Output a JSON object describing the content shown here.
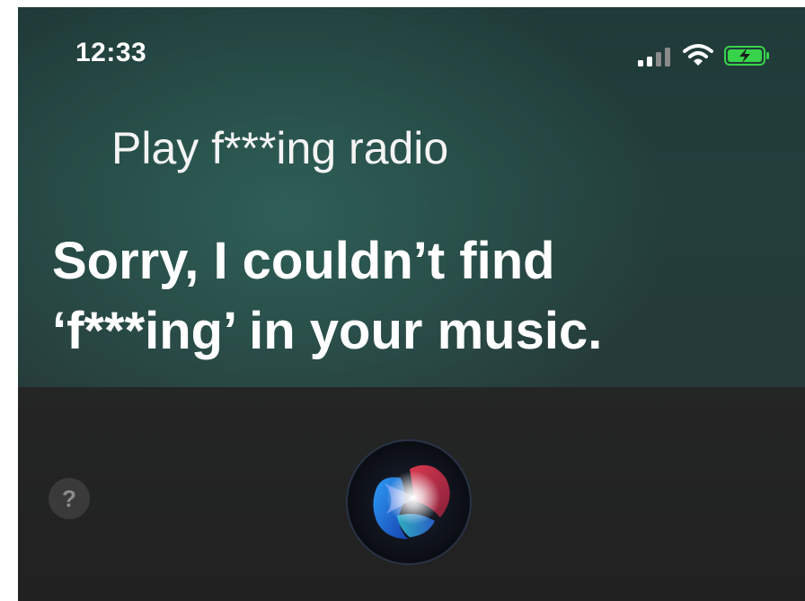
{
  "status_bar": {
    "time": "12:33",
    "icons": [
      "cellular-signal-icon",
      "wifi-icon",
      "battery-charging-icon"
    ]
  },
  "siri": {
    "query": "Play f***ing radio",
    "response_lines": [
      "Sorry, I couldn’t find",
      "‘f***ing’ in your music."
    ],
    "help_label": "?",
    "orb_icon": "siri-orb-icon"
  },
  "colors": {
    "battery_fill": "#37d34a",
    "background_top": "#2e5f57",
    "background_bottom": "#232323"
  }
}
